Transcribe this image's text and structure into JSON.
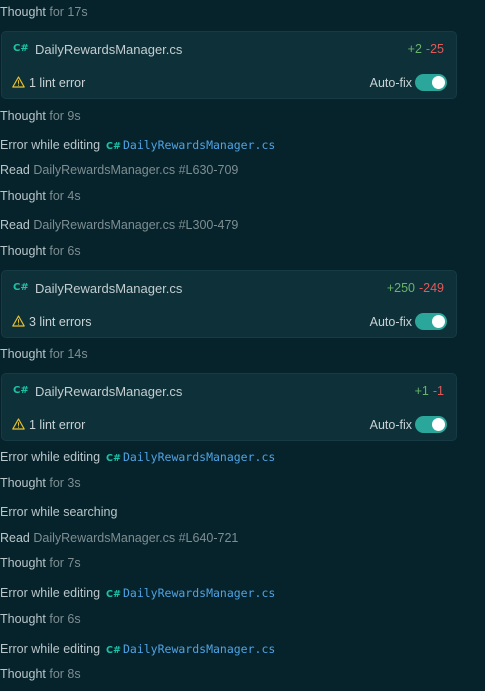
{
  "rows": {
    "r1": {
      "label": "Thought",
      "time": "for 17s"
    },
    "r2": {
      "label": "Thought",
      "time": "for 9s"
    },
    "r3": {
      "label": "Error while editing",
      "file": "DailyRewardsManager.cs"
    },
    "r4": {
      "label": "Read",
      "file": "DailyRewardsManager.cs",
      "range": "#L630-709"
    },
    "r5": {
      "label": "Thought",
      "time": "for 4s"
    },
    "r6": {
      "label": "Read",
      "file": "DailyRewardsManager.cs",
      "range": "#L300-479"
    },
    "r7": {
      "label": "Thought",
      "time": "for 6s"
    },
    "r8": {
      "label": "Thought",
      "time": "for 14s"
    },
    "r9": {
      "label": "Error while editing",
      "file": "DailyRewardsManager.cs"
    },
    "r10": {
      "label": "Thought",
      "time": "for 3s"
    },
    "r11": {
      "label": "Error while searching"
    },
    "r12": {
      "label": "Read",
      "file": "DailyRewardsManager.cs",
      "range": "#L640-721"
    },
    "r13": {
      "label": "Thought",
      "time": "for 7s"
    },
    "r14": {
      "label": "Error while editing",
      "file": "DailyRewardsManager.cs"
    },
    "r15": {
      "label": "Thought",
      "time": "for 6s"
    },
    "r16": {
      "label": "Error while editing",
      "file": "DailyRewardsManager.cs"
    },
    "r17": {
      "label": "Thought",
      "time": "for 8s"
    }
  },
  "cards": {
    "c1": {
      "lang": "C#",
      "file": "DailyRewardsManager.cs",
      "added": "+2",
      "removed": "-25",
      "lint": "1 lint error",
      "autofix": "Auto-fix",
      "autofix_on": true
    },
    "c2": {
      "lang": "C#",
      "file": "DailyRewardsManager.cs",
      "added": "+250",
      "removed": "-249",
      "lint": "3 lint errors",
      "autofix": "Auto-fix",
      "autofix_on": true
    },
    "c3": {
      "lang": "C#",
      "file": "DailyRewardsManager.cs",
      "added": "+1",
      "removed": "-1",
      "lint": "1 lint error",
      "autofix": "Auto-fix",
      "autofix_on": true
    }
  },
  "inline_lang": "C#",
  "colors": {
    "bg": "#06222b",
    "card_bg": "#0e3038",
    "added": "#67b46a",
    "removed": "#e05a5a",
    "toggle": "#2aa79a",
    "link": "#4fa3e3",
    "cs": "#1fc2a8",
    "warn": "#e8c12f"
  }
}
